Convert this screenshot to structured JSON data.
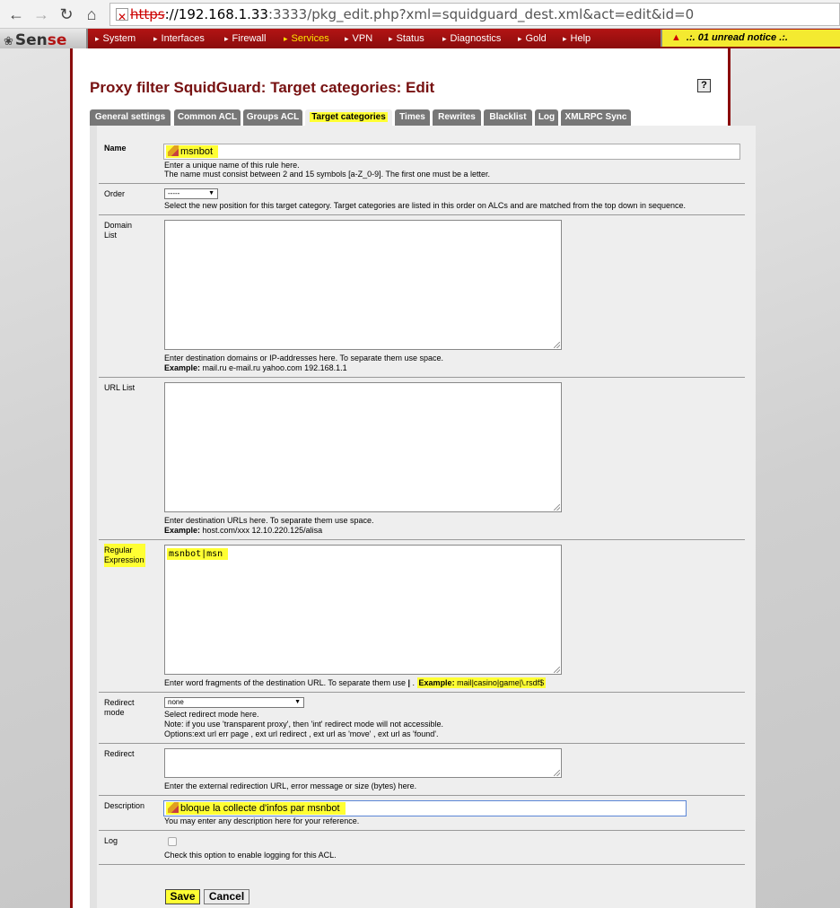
{
  "browser": {
    "url_scheme": "https",
    "url_host": "://192.168.1.33",
    "url_rest": ":3333/pkg_edit.php?xml=squidguard_dest.xml&act=edit&id=0"
  },
  "logo": {
    "prefix": "S",
    "text_a": "en",
    "text_b": "se"
  },
  "menu": [
    "System",
    "Interfaces",
    "Firewall",
    "Services",
    "VPN",
    "Status",
    "Diagnostics",
    "Gold",
    "Help"
  ],
  "notice": ".:. 01 unread notice .:.",
  "page_title": "Proxy filter SquidGuard: Target categories: Edit",
  "help": "?",
  "tabs": [
    "General settings",
    "Common ACL",
    "Groups ACL",
    "Target categories",
    "Times",
    "Rewrites",
    "Blacklist",
    "Log",
    "XMLRPC Sync"
  ],
  "form": {
    "name": {
      "label": "Name",
      "value": "msnbot",
      "desc1": "Enter a unique name of this rule here.",
      "desc2": "The name must consist between 2 and 15 symbols [a-Z_0-9]. The first one must be a letter."
    },
    "order": {
      "label": "Order",
      "value": "-----",
      "desc": "Select the new position for this target category. Target categories are listed in this order on ALCs and are matched from the top down in sequence."
    },
    "domain_list": {
      "label1": "Domain",
      "label2": "List",
      "value": "",
      "desc": "Enter destination domains or IP-addresses here. To separate them use space.",
      "example_label": "Example:",
      "example": " mail.ru e-mail.ru yahoo.com 192.168.1.1"
    },
    "url_list": {
      "label": "URL List",
      "value": "",
      "desc": "Enter destination URLs here. To separate them use space.",
      "example_label": "Example:",
      "example": " host.com/xxx 12.10.220.125/alisa"
    },
    "regex": {
      "label1": "Regular",
      "label2": "Expression",
      "value": "msnbot|msn",
      "desc": "Enter word fragments of the destination URL. To separate them use ",
      "pipe": "|",
      "desc_end": " .",
      "example_label": "Example:",
      "example": " mail|casino|game|\\.rsdf$"
    },
    "redirect_mode": {
      "label1": "Redirect",
      "label2": "mode",
      "value": "none",
      "desc1": "Select redirect mode here.",
      "desc2": "Note: if you use 'transparent proxy', then 'int' redirect mode will not accessible.",
      "desc3": "Options:ext url err page , ext url redirect , ext url as 'move' , ext url as 'found'."
    },
    "redirect": {
      "label": "Redirect",
      "value": "",
      "desc": "Enter the external redirection URL, error message or size (bytes) here."
    },
    "description": {
      "label": "Description",
      "value": "bloque la collecte d'infos par msnbot",
      "desc": "You may enter any description here for your reference."
    },
    "log": {
      "label": "Log",
      "desc": "Check this option to enable logging for this ACL."
    }
  },
  "buttons": {
    "save": "Save",
    "cancel": "Cancel"
  }
}
